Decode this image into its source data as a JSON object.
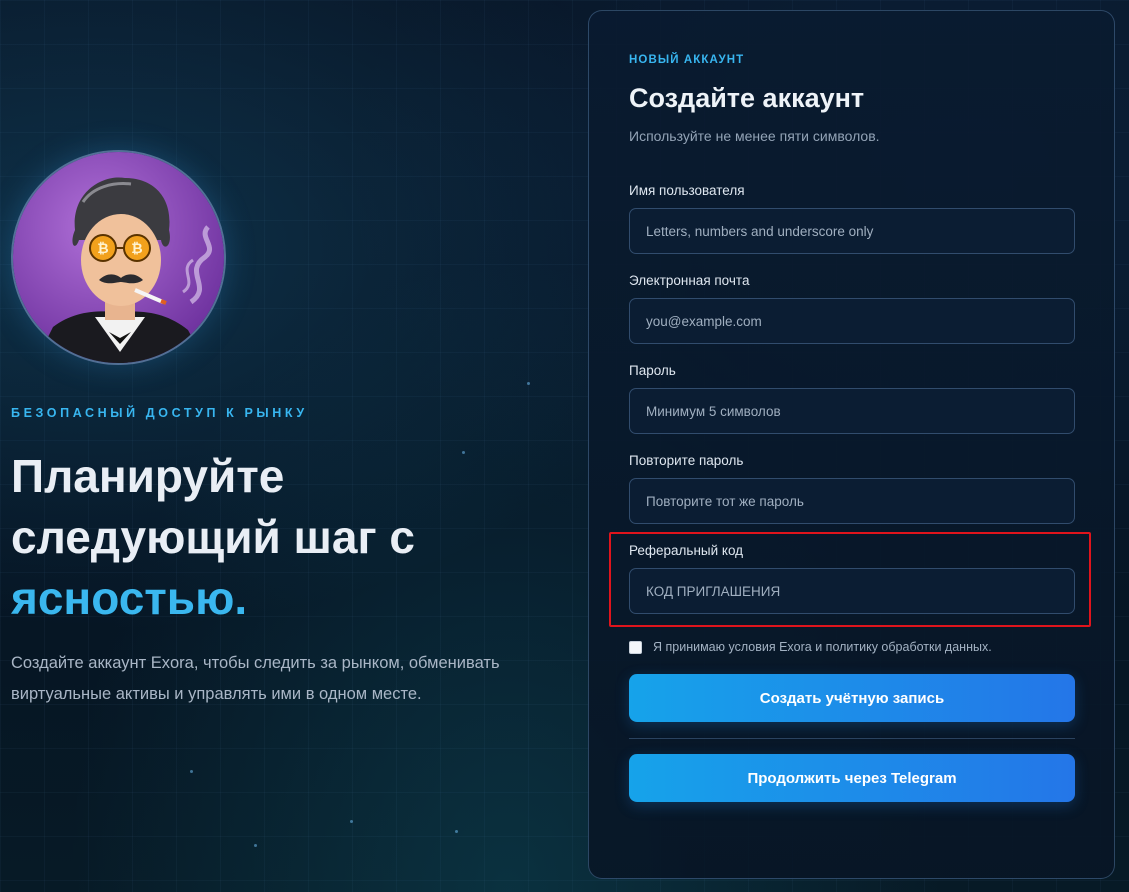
{
  "hero": {
    "eyebrow": "БЕЗОПАСНЫЙ ДОСТУП К РЫНКУ",
    "title_line1": "Планируйте",
    "title_line2": "следующий шаг с",
    "title_accent": "ясностью.",
    "description": "Создайте аккаунт Exora, чтобы следить за рынком, обменивать виртуальные активы и управлять ими в одном месте."
  },
  "form": {
    "eyebrow": "НОВЫЙ АККАУНТ",
    "title": "Создайте аккаунт",
    "subtitle": "Используйте не менее пяти символов.",
    "username": {
      "label": "Имя пользователя",
      "placeholder": "Letters, numbers and underscore only",
      "value": ""
    },
    "email": {
      "label": "Электронная почта",
      "placeholder": "you@example.com",
      "value": ""
    },
    "password": {
      "label": "Пароль",
      "placeholder": "Минимум 5 символов",
      "value": ""
    },
    "password_repeat": {
      "label": "Повторите пароль",
      "placeholder": "Повторите тот же пароль",
      "value": ""
    },
    "referral": {
      "label": "Реферальный код",
      "placeholder": "КОД ПРИГЛАШЕНИЯ",
      "value": ""
    },
    "terms": {
      "label": "Я принимаю условия Exora и политику обработки данных.",
      "checked": false
    },
    "submit_label": "Создать учётную запись",
    "telegram_label": "Продолжить через Telegram"
  },
  "colors": {
    "accent": "#38b6f0",
    "button_start": "#16a3ea",
    "button_end": "#2476e8",
    "highlight": "#e0141c"
  },
  "icons": {
    "avatar": "bitcoin-glasses-portrait"
  }
}
